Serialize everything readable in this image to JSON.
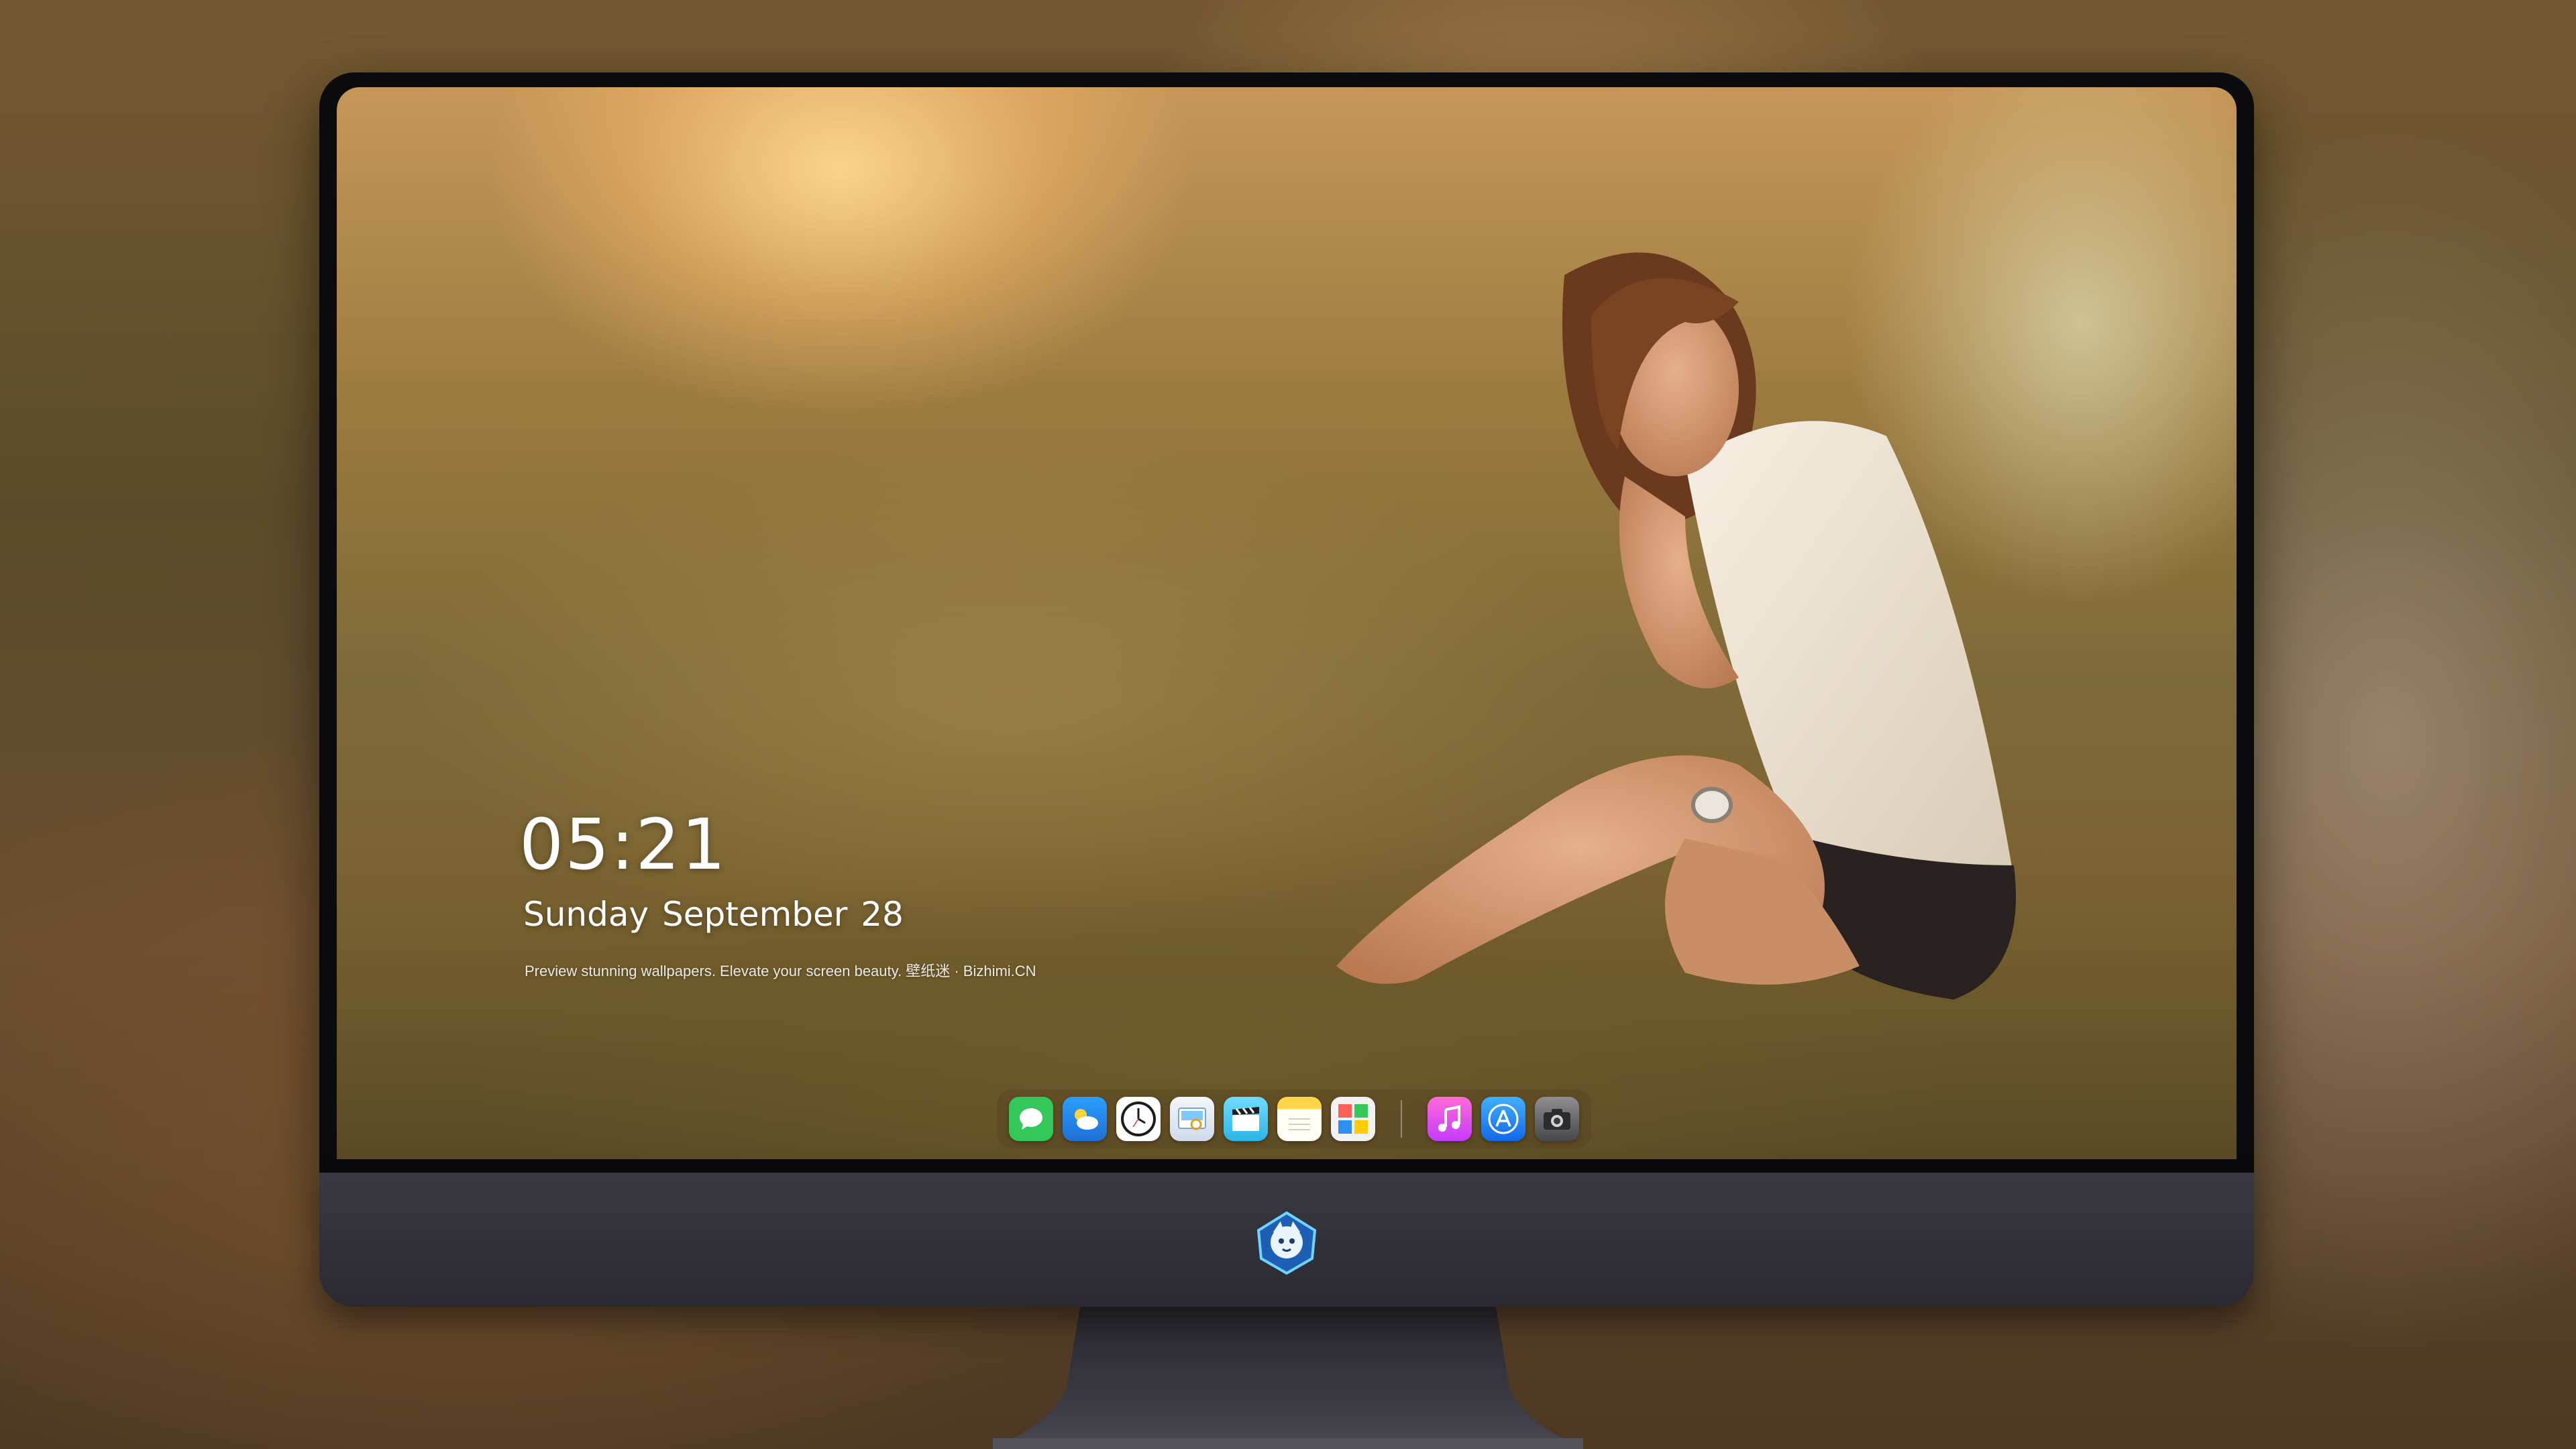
{
  "lockscreen": {
    "time": "05:21",
    "date": "Sunday September  28",
    "tagline": "Preview stunning wallpapers. Elevate your screen beauty. 壁纸迷 · Bizhimi.CN"
  },
  "dock": {
    "apps": [
      {
        "icon": "messages-icon",
        "color": "#34c759"
      },
      {
        "icon": "weather-icon",
        "color": "#2f8ff0"
      },
      {
        "icon": "clock-icon",
        "color": "#1c1c1e"
      },
      {
        "icon": "preview-icon",
        "color": "#e8eef6"
      },
      {
        "icon": "video-clapper-icon",
        "color": "#5ac8fa"
      },
      {
        "icon": "notes-icon",
        "color": "#ffd54a"
      },
      {
        "icon": "photo-booth-icon",
        "color": "#f2f2f2"
      },
      {
        "icon": "music-icon",
        "color": "#ff3b8d"
      },
      {
        "icon": "app-store-icon",
        "color": "#1a8cff"
      },
      {
        "icon": "camera-icon",
        "color": "#5a5a5e"
      }
    ]
  },
  "colors": {
    "bezel": "#0b0b0d",
    "chin": "#2b2a32",
    "text": "#ffffff"
  }
}
